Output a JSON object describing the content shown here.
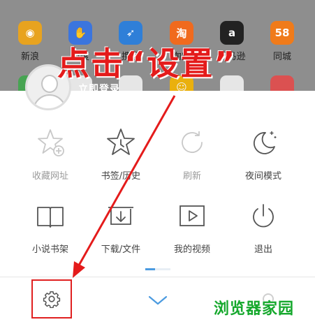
{
  "apps_row1": [
    {
      "label": "新浪",
      "glyph": "◉",
      "color": "#e8a31f"
    },
    {
      "label": "百度",
      "glyph": "✋",
      "color": "#3b75de"
    },
    {
      "label": "携程",
      "glyph": "➶",
      "color": "#2f7fd8"
    },
    {
      "label": "淘宝",
      "glyph": "淘",
      "color": "#f06a1e"
    },
    {
      "label": "亚马逊",
      "glyph": "a",
      "color": "#222222"
    },
    {
      "label": "同城",
      "glyph": "58",
      "color": "#f07b1a"
    }
  ],
  "apps_row2": [
    {
      "glyph": "",
      "color": "#3fa64b"
    },
    {
      "glyph": "",
      "color": "#f0f0f0"
    },
    {
      "glyph": "",
      "color": "#f0f0f0"
    },
    {
      "glyph": "☺",
      "color": "#f4b400"
    },
    {
      "glyph": "",
      "color": "#f0f0f0"
    },
    {
      "glyph": "",
      "color": "#e34a4a"
    }
  ],
  "login_text": "立即登录",
  "annotation": "点击“设置”",
  "menu": [
    {
      "label": "收藏网址",
      "icon": "star-plus-icon",
      "disabled": true
    },
    {
      "label": "书签/历史",
      "icon": "star-clock-icon",
      "disabled": false
    },
    {
      "label": "刷新",
      "icon": "refresh-icon",
      "disabled": true
    },
    {
      "label": "夜间模式",
      "icon": "moon-icon",
      "disabled": false
    },
    {
      "label": "小说书架",
      "icon": "book-icon",
      "disabled": false
    },
    {
      "label": "下载/文件",
      "icon": "download-icon",
      "disabled": false
    },
    {
      "label": "我的视频",
      "icon": "video-icon",
      "disabled": false
    },
    {
      "label": "退出",
      "icon": "power-icon",
      "disabled": false
    }
  ],
  "watermark": "浏览器家园",
  "colors": {
    "accent": "#4b9be0",
    "annotation": "#e41b1b",
    "watermark": "#15a82c"
  }
}
